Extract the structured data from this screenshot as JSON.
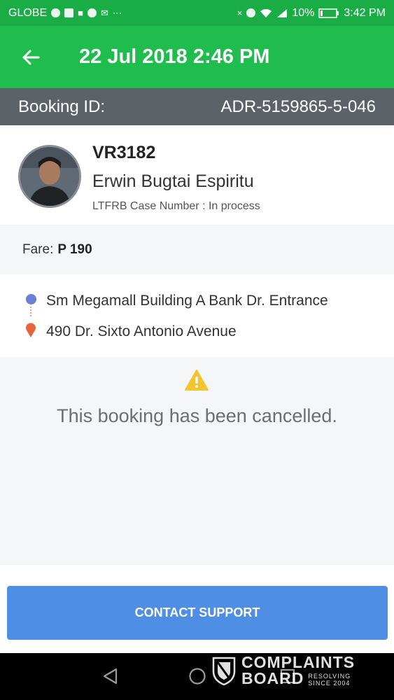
{
  "status_bar": {
    "carrier": "GLOBE",
    "notification_icons": [
      "chrome-icon",
      "facebook-icon",
      "car-icon",
      "messenger-icon",
      "mail-icon",
      "more-icon"
    ],
    "system_icons": [
      "mute-icon",
      "alarm-icon",
      "wifi-icon",
      "signal-icon"
    ],
    "battery": "10%",
    "time": "3:42 PM"
  },
  "header": {
    "title": "22 Jul 2018 2:46 PM"
  },
  "booking": {
    "label": "Booking ID:",
    "id": "ADR-5159865-5-046"
  },
  "driver": {
    "plate": "VR3182",
    "name": "Erwin Bugtai Espiritu",
    "case_number": "LTFRB Case Number : In process"
  },
  "fare": {
    "label": "Fare:",
    "value": "P 190"
  },
  "route": {
    "pickup": "Sm Megamall Building A Bank Dr. Entrance",
    "dropoff": "490 Dr. Sixto Antonio Avenue"
  },
  "notice": {
    "message": "This booking has been cancelled."
  },
  "actions": {
    "contact_support": "CONTACT SUPPORT"
  },
  "watermark": {
    "line1": "COMPLAINTS",
    "line2": "BOARD",
    "tag1": "RESOLVING",
    "tag2": "SINCE 2004"
  },
  "colors": {
    "status_bar": "#1aad46",
    "app_bar": "#1fbd4e",
    "booking_bar": "#5d6168",
    "button": "#4e8fe5",
    "pickup_dot": "#6b7fd7",
    "dropoff_pin": "#e8643c",
    "warning": "#f3c42d"
  }
}
